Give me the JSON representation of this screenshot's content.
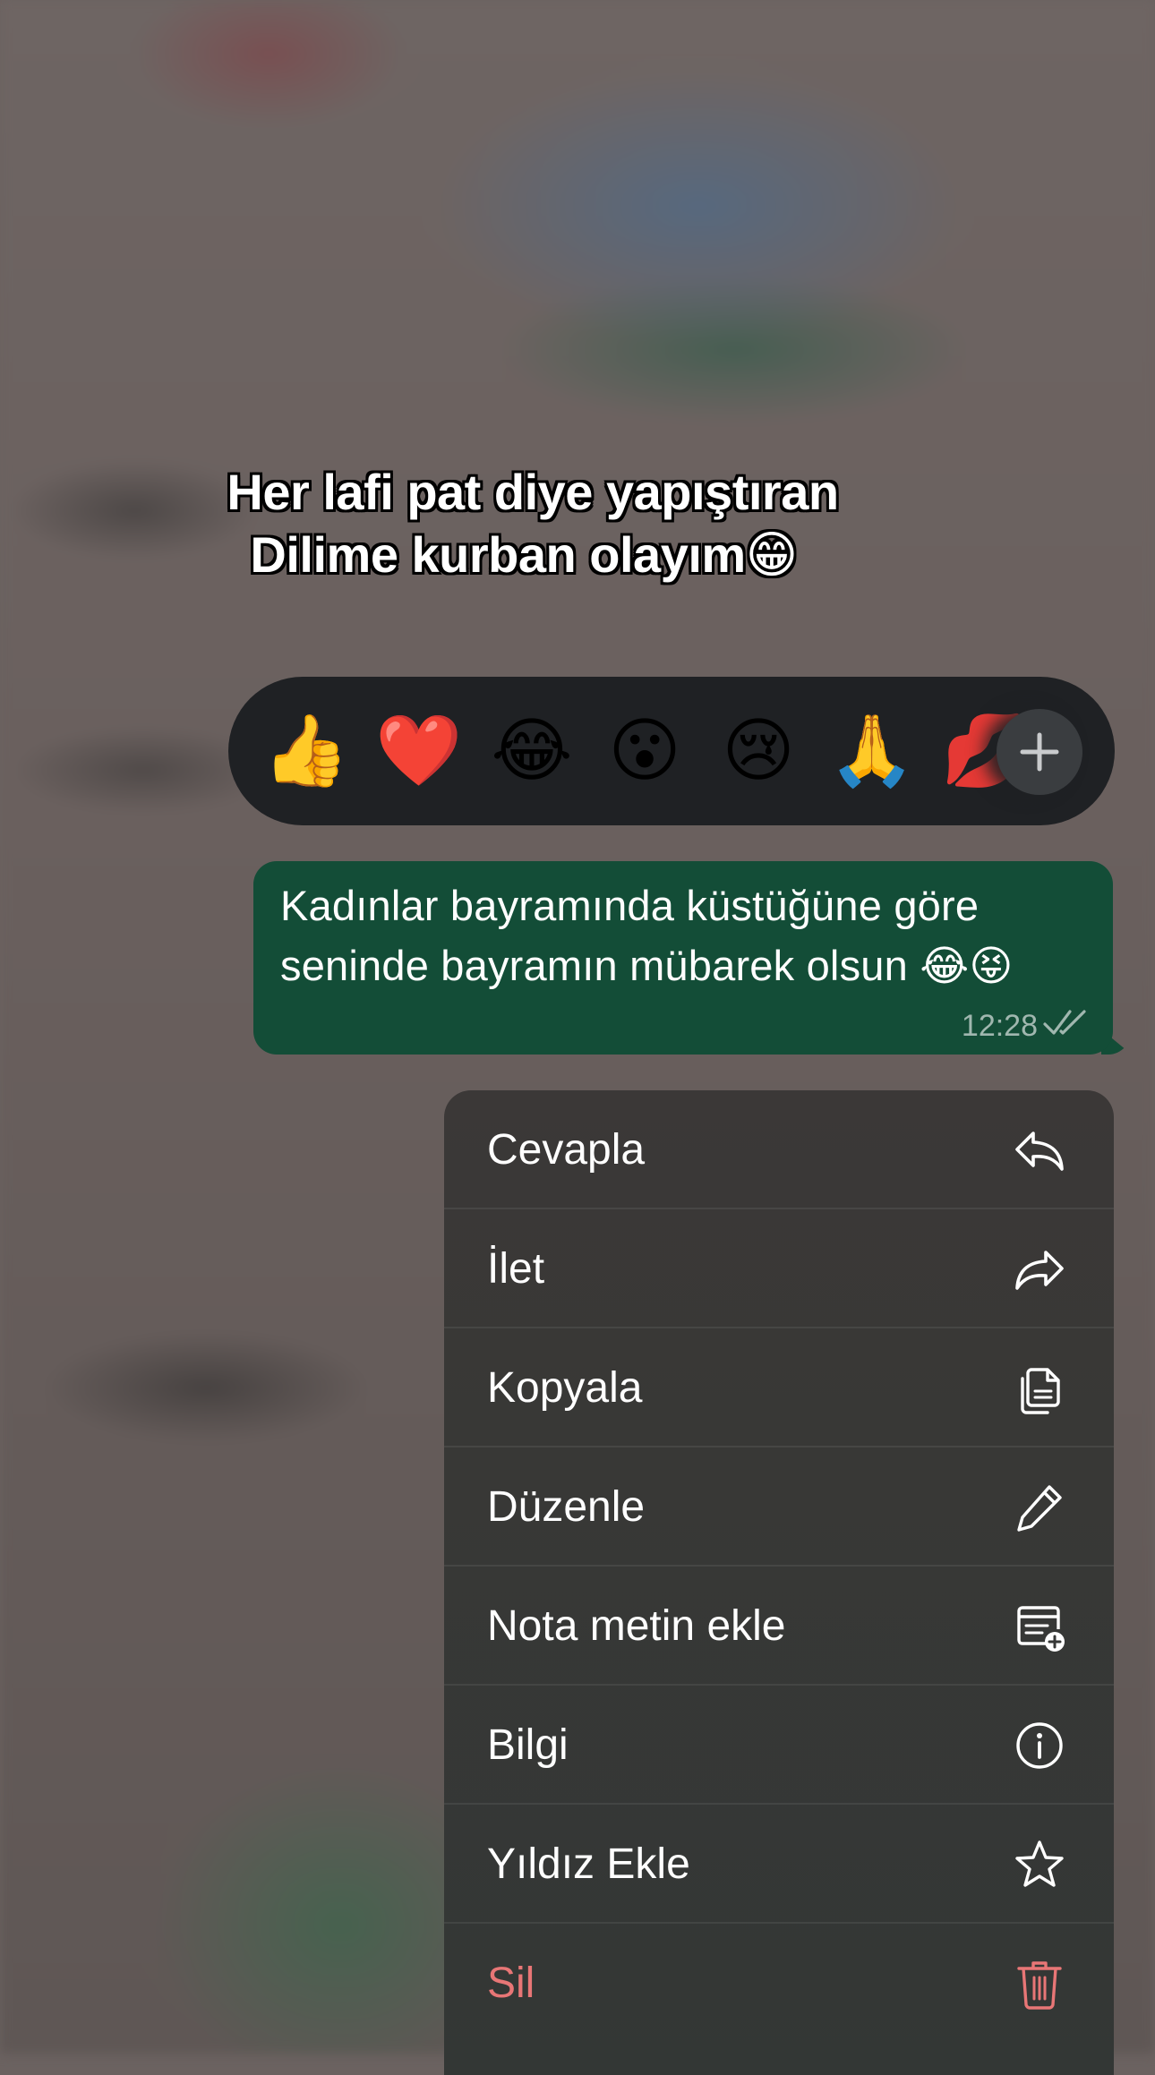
{
  "caption": {
    "line1": "Her lafi pat diye yapıştıran",
    "line2": "Dilime kurban olayım😁"
  },
  "reactions": [
    {
      "emoji": "👍",
      "name": "thumbs-up"
    },
    {
      "emoji": "❤️",
      "name": "heart"
    },
    {
      "emoji": "😂",
      "name": "tears-of-joy"
    },
    {
      "emoji": "😮",
      "name": "surprised"
    },
    {
      "emoji": "😢",
      "name": "crying"
    },
    {
      "emoji": "🙏",
      "name": "folded-hands"
    },
    {
      "emoji": "💋",
      "name": "kiss-mark"
    }
  ],
  "reaction_more_icon": "plus-icon",
  "message": {
    "line1": "Kadınlar bayramında küstüğüne göre",
    "line2": "seninde bayramın mübarek olsun 😂😝",
    "time": "12:28",
    "status_icon": "double-check-icon",
    "bubble_color": "#134d37"
  },
  "menu": {
    "items": [
      {
        "label": "Cevapla",
        "icon": "reply-icon"
      },
      {
        "label": "İlet",
        "icon": "forward-icon"
      },
      {
        "label": "Kopyala",
        "icon": "copy-icon"
      },
      {
        "label": "Düzenle",
        "icon": "pencil-icon"
      },
      {
        "label": "Nota metin ekle",
        "icon": "add-note-icon"
      },
      {
        "label": "Bilgi",
        "icon": "info-icon"
      },
      {
        "label": "Yıldız Ekle",
        "icon": "star-icon"
      },
      {
        "label": "Sil",
        "icon": "trash-icon",
        "danger_color": "#e87676"
      }
    ]
  }
}
